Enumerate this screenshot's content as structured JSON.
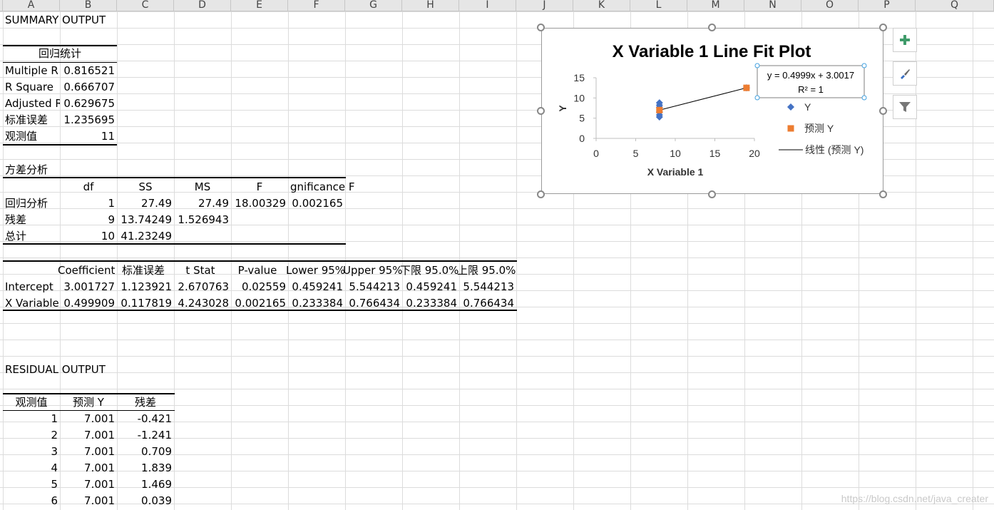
{
  "columns": [
    "A",
    "B",
    "C",
    "D",
    "E",
    "F",
    "G",
    "H",
    "I",
    "J",
    "K",
    "L",
    "M",
    "N",
    "O",
    "P",
    "Q"
  ],
  "summary_title": "SUMMARY OUTPUT",
  "regression_stats": {
    "header": "回归统计",
    "rows": [
      [
        "Multiple R",
        "0.816521"
      ],
      [
        "R Square",
        "0.666707"
      ],
      [
        "Adjusted R",
        "0.629675"
      ],
      [
        "标准误差",
        "1.235695"
      ],
      [
        "观测值",
        "11"
      ]
    ]
  },
  "anova": {
    "title": "方差分析",
    "headers": [
      "",
      "df",
      "SS",
      "MS",
      "F",
      "gnificance F"
    ],
    "rows": [
      [
        "回归分析",
        "1",
        "27.49",
        "27.49",
        "18.00329",
        "0.002165"
      ],
      [
        "残差",
        "9",
        "13.74249",
        "1.526943",
        "",
        ""
      ],
      [
        "总计",
        "10",
        "41.23249",
        "",
        "",
        ""
      ]
    ]
  },
  "coefficients": {
    "headers": [
      "",
      "Coefficient",
      "标准误差",
      "t Stat",
      "P-value",
      "Lower 95%",
      "Upper 95%",
      "下限 95.0%",
      "上限 95.0%"
    ],
    "rows": [
      [
        "Intercept",
        "3.001727",
        "1.123921",
        "2.670763",
        "0.02559",
        "0.459241",
        "5.544213",
        "0.459241",
        "5.544213"
      ],
      [
        "X Variable",
        "0.499909",
        "0.117819",
        "4.243028",
        "0.002165",
        "0.233384",
        "0.766434",
        "0.233384",
        "0.766434"
      ]
    ]
  },
  "residual": {
    "title": "RESIDUAL OUTPUT",
    "headers": [
      "观测值",
      "预测 Y",
      "残差"
    ],
    "rows": [
      [
        "1",
        "7.001",
        "-0.421"
      ],
      [
        "2",
        "7.001",
        "-1.241"
      ],
      [
        "3",
        "7.001",
        "0.709"
      ],
      [
        "4",
        "7.001",
        "1.839"
      ],
      [
        "5",
        "7.001",
        "1.469"
      ],
      [
        "6",
        "7.001",
        "0.039"
      ]
    ]
  },
  "chart_data": {
    "type": "scatter",
    "title": "X Variable 1 Line Fit  Plot",
    "xlabel": "X Variable 1",
    "ylabel": "Y",
    "xlim": [
      0,
      20
    ],
    "ylim": [
      0,
      15
    ],
    "xticks": [
      "0",
      "5",
      "10",
      "15",
      "20"
    ],
    "yticks": [
      "0",
      "5",
      "10",
      "15"
    ],
    "series": [
      {
        "name": "Y",
        "marker": "diamond",
        "color": "#4472c4",
        "points": [
          [
            8,
            5.3
          ],
          [
            8,
            5.8
          ],
          [
            8,
            6.5
          ],
          [
            8,
            7.7
          ],
          [
            8,
            8.2
          ],
          [
            8,
            8.8
          ],
          [
            19,
            12.5
          ]
        ]
      },
      {
        "name": "预测 Y",
        "marker": "square",
        "color": "#ed7d31",
        "points": [
          [
            8,
            7.0
          ],
          [
            19,
            12.5
          ]
        ]
      }
    ],
    "trendline": {
      "legend": "线性 (预测 Y)",
      "from": [
        8,
        7.0
      ],
      "to": [
        19,
        12.5
      ],
      "color": "#000000"
    },
    "equation": "y = 0.4999x + 3.0017",
    "r2": "R² = 1"
  },
  "icons": {
    "add": "plus-icon",
    "style": "brush-icon",
    "filter": "filter-icon"
  },
  "watermark": "https://blog.csdn.net/java_creater"
}
